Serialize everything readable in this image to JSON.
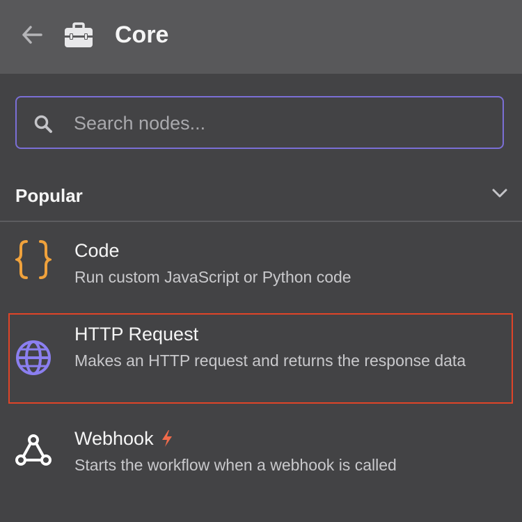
{
  "header": {
    "title": "Core",
    "back_icon": "arrow-left-icon",
    "category_icon": "toolbox-icon"
  },
  "search": {
    "placeholder": "Search nodes...",
    "value": "",
    "icon": "search-icon"
  },
  "section": {
    "title": "Popular",
    "chevron_icon": "chevron-down-icon"
  },
  "items": [
    {
      "title": "Code",
      "description": "Run custom JavaScript or Python code",
      "icon": "code-braces-icon",
      "icon_color": "#f0a23c"
    },
    {
      "title": "HTTP Request",
      "description": "Makes an HTTP request and returns the response data",
      "icon": "globe-icon",
      "icon_color": "#8b7ff0",
      "highlighted": true,
      "highlight_color": "#e04428"
    },
    {
      "title": "Webhook",
      "description": "Starts the workflow when a webhook is called",
      "icon": "webhook-icon",
      "icon_color": "#ffffff",
      "badge_icon": "bolt-icon",
      "badge_color": "#f06a4a"
    }
  ],
  "colors": {
    "background": "#434345",
    "header_background": "#58585a",
    "search_border": "#7b6fd6"
  }
}
